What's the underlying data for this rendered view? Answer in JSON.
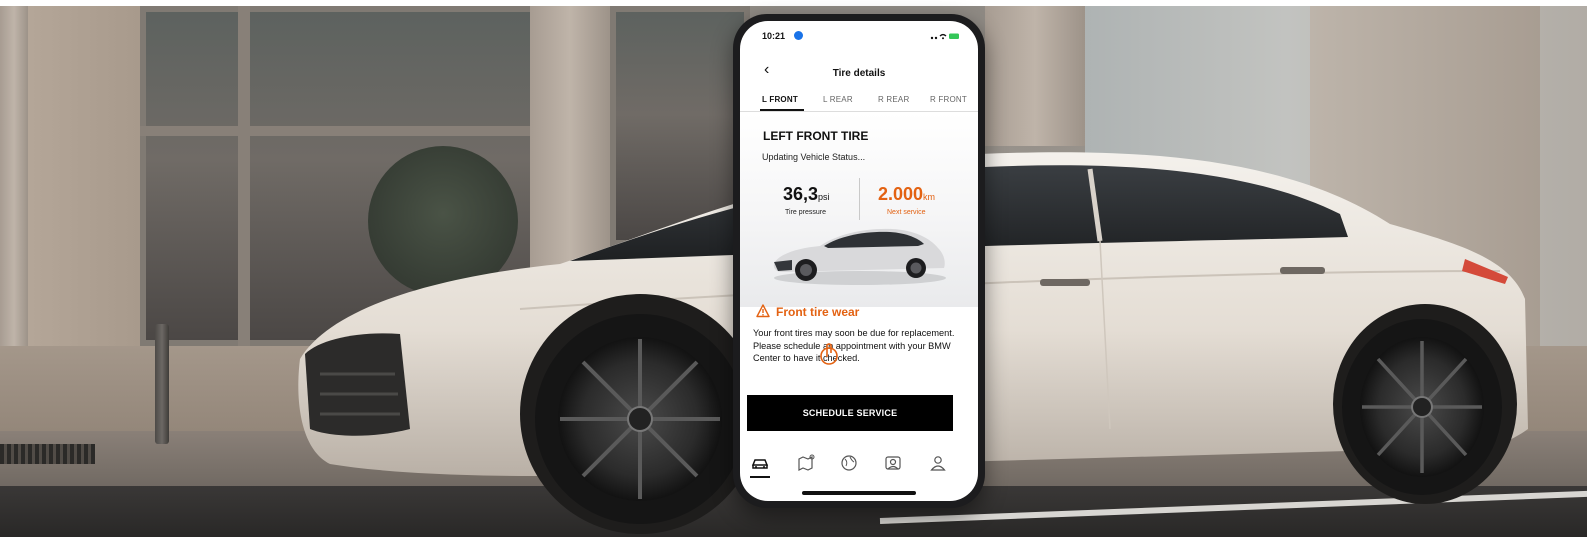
{
  "app": {
    "status_time": "10:21",
    "header_title": "Tire details",
    "tabs": [
      {
        "label": "L FRONT",
        "active": true
      },
      {
        "label": "L REAR",
        "active": false
      },
      {
        "label": "R REAR",
        "active": false
      },
      {
        "label": "R FRONT",
        "active": false
      }
    ],
    "tire": {
      "title": "LEFT FRONT TIRE",
      "status": "Updating Vehicle Status...",
      "pressure_value": "36,3",
      "pressure_unit": "psi",
      "pressure_label": "Tire pressure",
      "service_value": "2.000",
      "service_unit": "km",
      "service_label": "Next service"
    },
    "warning": {
      "title": "Front tire wear",
      "body": "Your front tires may soon be due for replacement. Please schedule an appointment with your BMW Center to have it checked."
    },
    "cta_label": "SCHEDULE SERVICE",
    "tabbar_icons": [
      "car-icon",
      "map-icon",
      "globe-icon",
      "service-icon",
      "profile-icon"
    ],
    "colors": {
      "accent_orange": "#e36212",
      "cta_background": "#000000",
      "status_badge": "#1a73e8",
      "battery": "#34c759"
    }
  }
}
